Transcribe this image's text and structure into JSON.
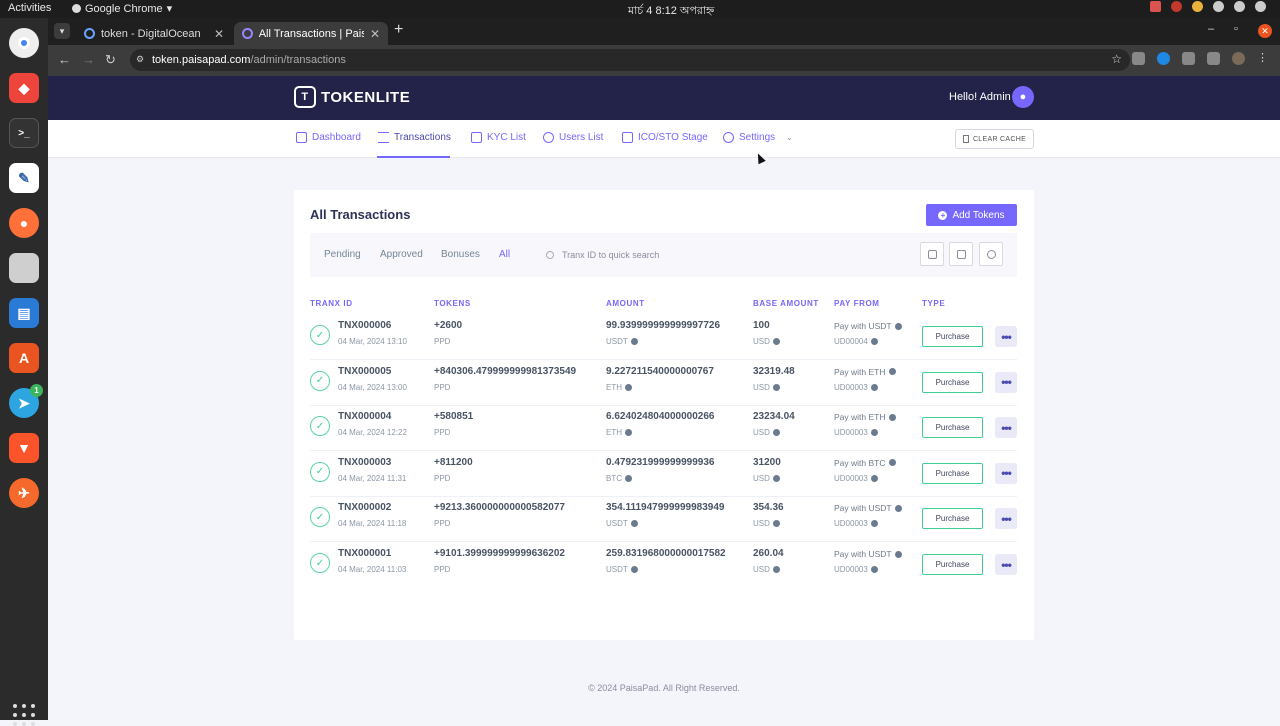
{
  "system": {
    "activities": "Activities",
    "app_name": "Google Chrome",
    "clock": "মার্চ 4  8:12 অপরাহ্ন"
  },
  "browser": {
    "tabs": [
      {
        "title": "token - DigitalOcean"
      },
      {
        "title": "All Transactions | PaisaP"
      }
    ],
    "url_host": "token.paisapad.com",
    "url_path": "/admin/transactions"
  },
  "header": {
    "logo_text": "TOKENLITE",
    "greeting": "Hello! Admin"
  },
  "nav": {
    "items": [
      {
        "label": "Dashboard"
      },
      {
        "label": "Transactions"
      },
      {
        "label": "KYC List"
      },
      {
        "label": "Users List"
      },
      {
        "label": "ICO/STO Stage"
      },
      {
        "label": "Settings"
      }
    ],
    "clear_cache": "CLEAR CACHE"
  },
  "page": {
    "title": "All Transactions",
    "add_button": "Add Tokens",
    "filters": [
      "Pending",
      "Approved",
      "Bonuses",
      "All"
    ],
    "active_filter": "All",
    "search_placeholder": "Tranx ID to quick search"
  },
  "table": {
    "headers": [
      "TRANX ID",
      "TOKENS",
      "AMOUNT",
      "BASE AMOUNT",
      "PAY FROM",
      "TYPE"
    ],
    "rows": [
      {
        "id": "TNX000006",
        "date": "04 Mar, 2024 13:10",
        "tokens": "+2600",
        "token_unit": "PPD",
        "amount": "99.939999999999997726",
        "amount_unit": "USDT",
        "base": "100",
        "base_unit": "USD",
        "pay": "Pay with USDT",
        "pay_id": "UD00004",
        "type": "Purchase"
      },
      {
        "id": "TNX000005",
        "date": "04 Mar, 2024 13:00",
        "tokens": "+840306.479999999981373549",
        "token_unit": "PPD",
        "amount": "9.227211540000000767",
        "amount_unit": "ETH",
        "base": "32319.48",
        "base_unit": "USD",
        "pay": "Pay with ETH",
        "pay_id": "UD00003",
        "type": "Purchase"
      },
      {
        "id": "TNX000004",
        "date": "04 Mar, 2024 12:22",
        "tokens": "+580851",
        "token_unit": "PPD",
        "amount": "6.624024804000000266",
        "amount_unit": "ETH",
        "base": "23234.04",
        "base_unit": "USD",
        "pay": "Pay with ETH",
        "pay_id": "UD00003",
        "type": "Purchase"
      },
      {
        "id": "TNX000003",
        "date": "04 Mar, 2024 11:31",
        "tokens": "+811200",
        "token_unit": "PPD",
        "amount": "0.479231999999999936",
        "amount_unit": "BTC",
        "base": "31200",
        "base_unit": "USD",
        "pay": "Pay with BTC",
        "pay_id": "UD00003",
        "type": "Purchase"
      },
      {
        "id": "TNX000002",
        "date": "04 Mar, 2024 11:18",
        "tokens": "+9213.360000000000582077",
        "token_unit": "PPD",
        "amount": "354.111947999999983949",
        "amount_unit": "USDT",
        "base": "354.36",
        "base_unit": "USD",
        "pay": "Pay with USDT",
        "pay_id": "UD00003",
        "type": "Purchase"
      },
      {
        "id": "TNX000001",
        "date": "04 Mar, 2024 11:03",
        "tokens": "+9101.399999999999636202",
        "token_unit": "PPD",
        "amount": "259.831968000000017582",
        "amount_unit": "USDT",
        "base": "260.04",
        "base_unit": "USD",
        "pay": "Pay with USDT",
        "pay_id": "UD00003",
        "type": "Purchase"
      }
    ]
  },
  "footer": "© 2024 PaisaPad. All Right Reserved.",
  "colors": {
    "accent": "#7668fe",
    "header_bg": "#232349",
    "success": "#3fcf8e"
  }
}
